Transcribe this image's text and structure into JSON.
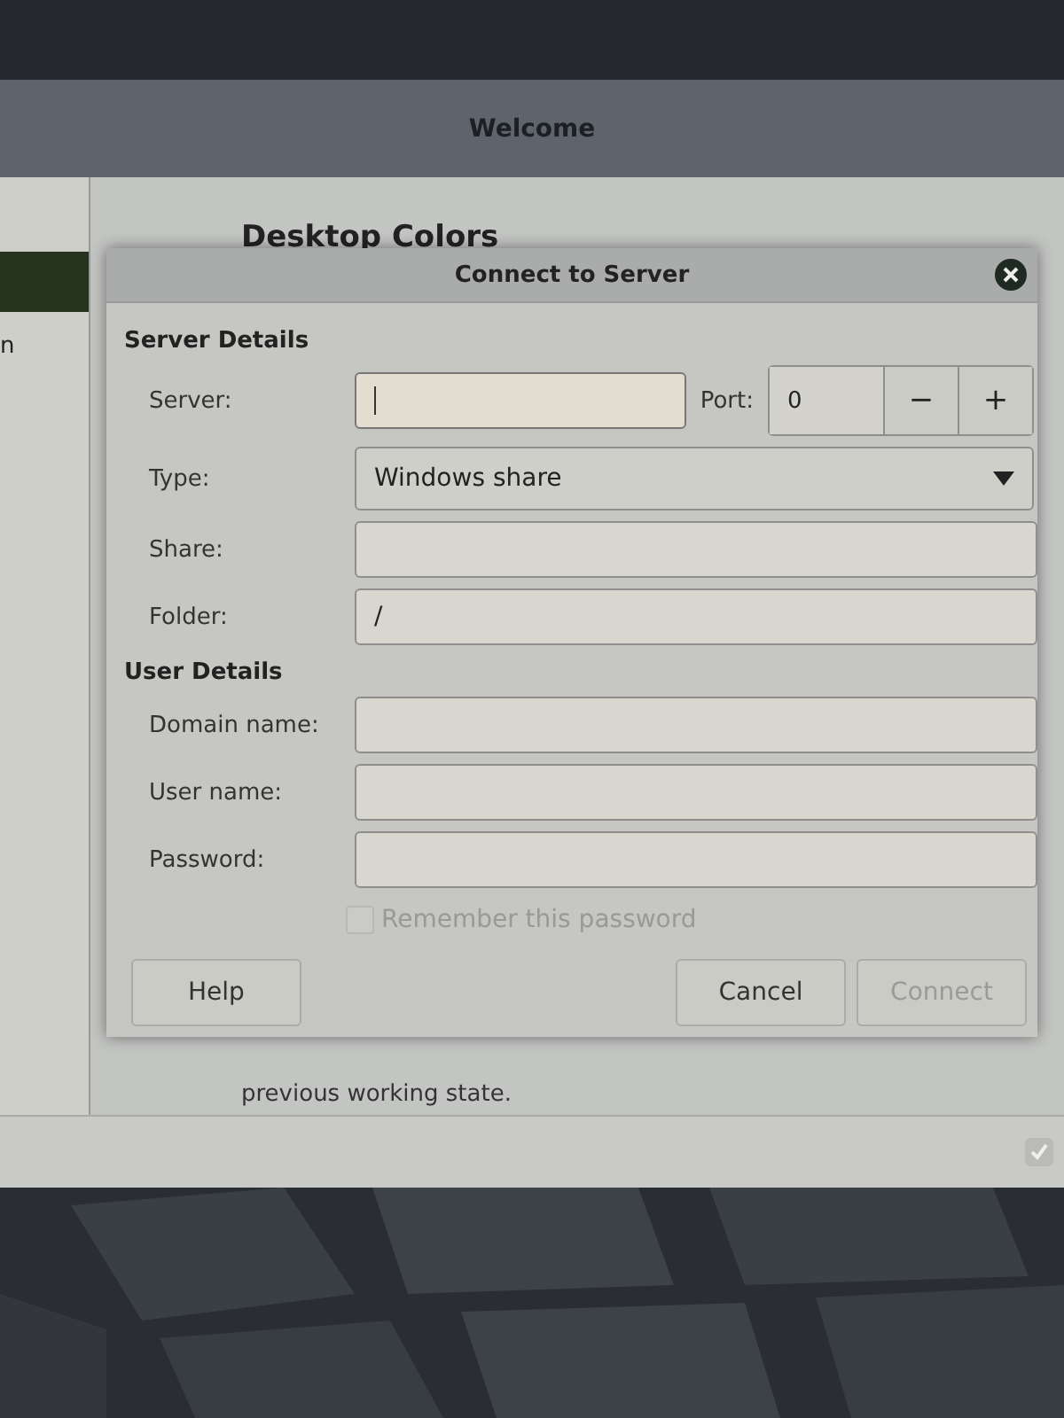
{
  "background_window": {
    "title": "Welcome",
    "sidebar_label": "n",
    "heading": "Desktop Colors",
    "body_text": "previous working state.",
    "footer_checkbox": {
      "checked": true
    }
  },
  "dialog": {
    "title": "Connect to Server",
    "sections": [
      {
        "heading": "Server Details",
        "rows": [
          {
            "kind": "server",
            "label": "Server:",
            "value": "",
            "focused": true,
            "port_label": "Port:",
            "port_value": "0",
            "decrement": "−",
            "increment": "+"
          },
          {
            "kind": "dropdown",
            "label": "Type:",
            "value": "Windows share"
          },
          {
            "kind": "entry",
            "label": "Share:",
            "value": ""
          },
          {
            "kind": "entry",
            "label": "Folder:",
            "value": "/"
          }
        ]
      },
      {
        "heading": "User Details",
        "rows": [
          {
            "kind": "entry",
            "label": "Domain name:",
            "value": ""
          },
          {
            "kind": "entry",
            "label": "User name:",
            "value": ""
          },
          {
            "kind": "entry",
            "label": "Password:",
            "value": ""
          }
        ]
      }
    ],
    "remember": {
      "label": "Remember this password",
      "checked": false,
      "disabled": true
    },
    "left_buttons": [
      {
        "label": "Help",
        "disabled": false
      }
    ],
    "right_buttons": [
      {
        "label": "Cancel",
        "disabled": false
      },
      {
        "label": "Connect",
        "disabled": true
      }
    ]
  }
}
